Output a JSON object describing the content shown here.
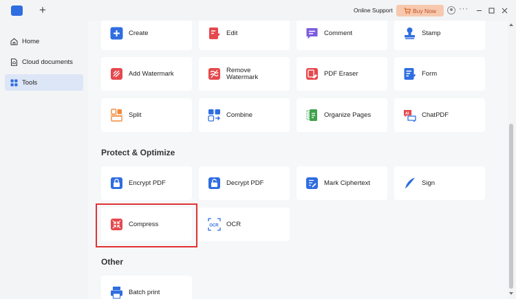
{
  "titlebar": {
    "new_tab": "+",
    "online_support": "Online Support",
    "buy_now": "Buy Now",
    "menu": "···"
  },
  "sidebar": {
    "items": [
      {
        "label": "Home",
        "icon": "home-icon"
      },
      {
        "label": "Cloud documents",
        "icon": "cloud-document-icon"
      },
      {
        "label": "Tools",
        "icon": "tools-grid-icon",
        "active": true
      }
    ]
  },
  "tools": {
    "row1": [
      {
        "label": "Create",
        "icon": "create-plus-icon"
      },
      {
        "label": "Edit",
        "icon": "edit-icon"
      },
      {
        "label": "Comment",
        "icon": "comment-icon"
      },
      {
        "label": "Stamp",
        "icon": "stamp-icon"
      }
    ],
    "row2": [
      {
        "label": "Add Watermark",
        "icon": "add-watermark-icon"
      },
      {
        "label": "Remove Watermark",
        "icon": "remove-watermark-icon"
      },
      {
        "label": "PDF Eraser",
        "icon": "pdf-eraser-icon"
      },
      {
        "label": "Form",
        "icon": "form-icon"
      }
    ],
    "row3": [
      {
        "label": "Split",
        "icon": "split-icon"
      },
      {
        "label": "Combine",
        "icon": "combine-icon"
      },
      {
        "label": "Organize Pages",
        "icon": "organize-pages-icon"
      },
      {
        "label": "ChatPDF",
        "icon": "chatpdf-icon"
      }
    ]
  },
  "protect": {
    "title": "Protect & Optimize",
    "row1": [
      {
        "label": "Encrypt PDF",
        "icon": "encrypt-lock-icon"
      },
      {
        "label": "Decrypt PDF",
        "icon": "decrypt-unlock-icon"
      },
      {
        "label": "Mark Ciphertext",
        "icon": "mark-ciphertext-icon"
      },
      {
        "label": "Sign",
        "icon": "sign-pen-icon"
      }
    ],
    "row2": [
      {
        "label": "Compress",
        "icon": "compress-icon"
      },
      {
        "label": "OCR",
        "icon": "ocr-icon"
      }
    ]
  },
  "other": {
    "title": "Other",
    "items": [
      {
        "label": "Batch print",
        "icon": "batch-print-icon"
      }
    ]
  },
  "colors": {
    "blue": "#2f6de1",
    "red": "#e5484d",
    "purple": "#7b5ce0",
    "green": "#3fa34d",
    "orange": "#f08a3c",
    "highlight": "#e03131"
  }
}
